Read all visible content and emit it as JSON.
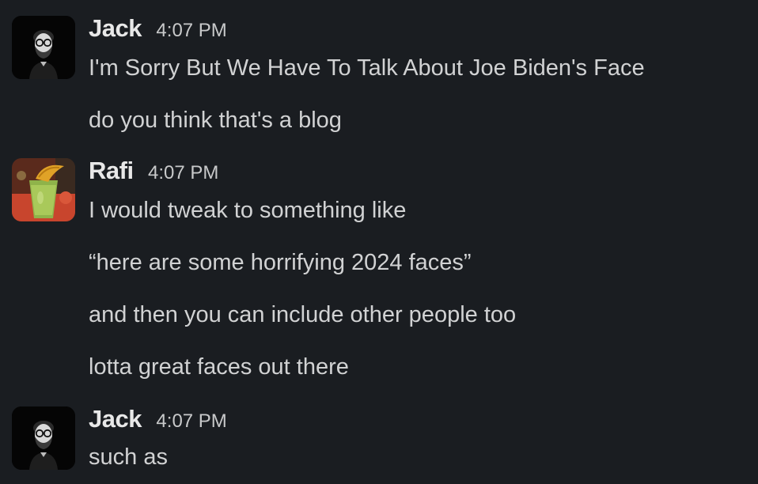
{
  "groups": [
    {
      "author": "Jack",
      "time": "4:07 PM",
      "avatar_icon": "man-with-glasses-avatar",
      "messages": [
        "I'm Sorry But We Have To Talk About Joe Biden's Face",
        "do you think that's a blog"
      ]
    },
    {
      "author": "Rafi",
      "time": "4:07 PM",
      "avatar_icon": "green-cocktail-avatar",
      "messages": [
        "I would tweak to something like",
        "“here are some horrifying 2024 faces”",
        "and then you can include other people too",
        "lotta great faces out there"
      ]
    },
    {
      "author": "Jack",
      "time": "4:07 PM",
      "avatar_icon": "man-with-glasses-avatar",
      "messages": [
        "such as"
      ]
    }
  ],
  "colors": {
    "background": "#1a1d21",
    "text": "#d1d2d3",
    "author": "#e8e8e8"
  }
}
